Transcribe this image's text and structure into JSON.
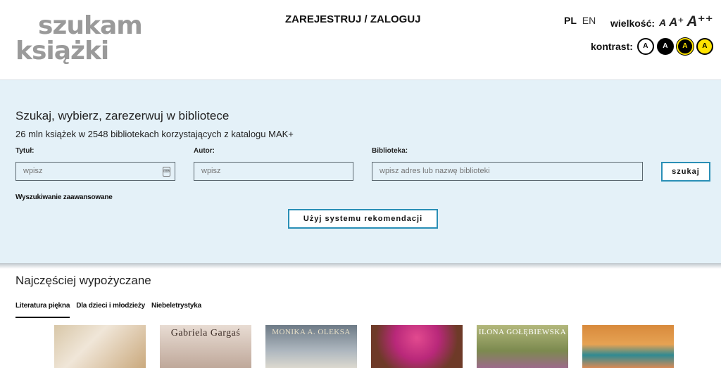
{
  "header": {
    "logo": {
      "line1": "szukam",
      "line2": "książki"
    },
    "login_label": "ZAREJESTRUJ / ZALOGUJ",
    "lang": {
      "pl": "PL",
      "en": "EN"
    },
    "font_size": {
      "label": "wielkość:",
      "a1": "A",
      "a2": "A⁺",
      "a3": "A⁺⁺"
    },
    "contrast": {
      "label": "kontrast:",
      "options": [
        "A",
        "A",
        "A",
        "A"
      ]
    }
  },
  "search": {
    "title": "Szukaj, wybierz, zarezerwuj w bibliotece",
    "subtitle": "26 mln książek w 2548 bibliotekach korzystających z katalogu MAK+",
    "title_field": {
      "label": "Tytuł:",
      "placeholder": "wpisz"
    },
    "author_field": {
      "label": "Autor:",
      "placeholder": "wpisz"
    },
    "library_field": {
      "label": "Biblioteka:",
      "placeholder": "wpisz adres lub nazwę biblioteki"
    },
    "search_button": "szukaj",
    "advanced_link": "Wyszukiwanie zaawansowane",
    "recommend_button": "Użyj systemu rekomendacji"
  },
  "popular": {
    "title": "Najczęściej wypożyczane",
    "tabs": [
      "Literatura piękna",
      "Dla dzieci i młodzieży",
      "Niebeletrystyka"
    ],
    "books": [
      {
        "author": ""
      },
      {
        "author": "Gabriela Gargaś"
      },
      {
        "author": "MONIKA A. OLEKSA"
      },
      {
        "author": ""
      },
      {
        "author": "ILONA GOŁĘBIEWSKA"
      },
      {
        "author": ""
      }
    ]
  },
  "colors": {
    "accent": "#2a8fb6",
    "search_bg": "#e4f1f8",
    "logo_red": "#e0262d",
    "logo_teal": "#17a0a8"
  }
}
